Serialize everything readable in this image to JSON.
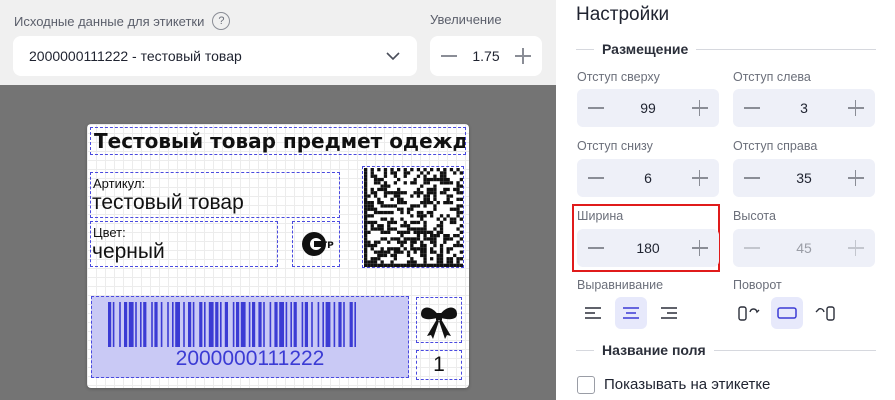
{
  "source": {
    "label": "Исходные данные для этикетки",
    "help": "?",
    "selected": "2000000111222 - тестовый товар"
  },
  "zoom": {
    "label": "Увеличение",
    "value": "1.75"
  },
  "label_preview": {
    "title": "Тестовый товар предмет одежды",
    "article_caption": "Артикул:",
    "article_value": "тестовый товар",
    "color_caption": "Цвет:",
    "color_value": "черный",
    "eac_text": "EAC",
    "barcode_number": "2000000111222",
    "count": "1"
  },
  "settings": {
    "title": "Настройки",
    "placement_section": "Размещение",
    "top_margin": {
      "label": "Отступ сверху",
      "value": "99"
    },
    "left_margin": {
      "label": "Отступ слева",
      "value": "3"
    },
    "bottom_margin": {
      "label": "Отступ снизу",
      "value": "6"
    },
    "right_margin": {
      "label": "Отступ справа",
      "value": "35"
    },
    "width": {
      "label": "Ширина",
      "value": "180"
    },
    "height": {
      "label": "Высота",
      "value": "45"
    },
    "align_label": "Выравнивание",
    "rotation_label": "Поворот",
    "field_name_section": "Название поля",
    "show_on_label": "Показывать на этикетке"
  },
  "colors": {
    "accent": "#3b3bd4",
    "highlight": "#e01b1b",
    "barcode_bg": "#c9c9f5"
  }
}
